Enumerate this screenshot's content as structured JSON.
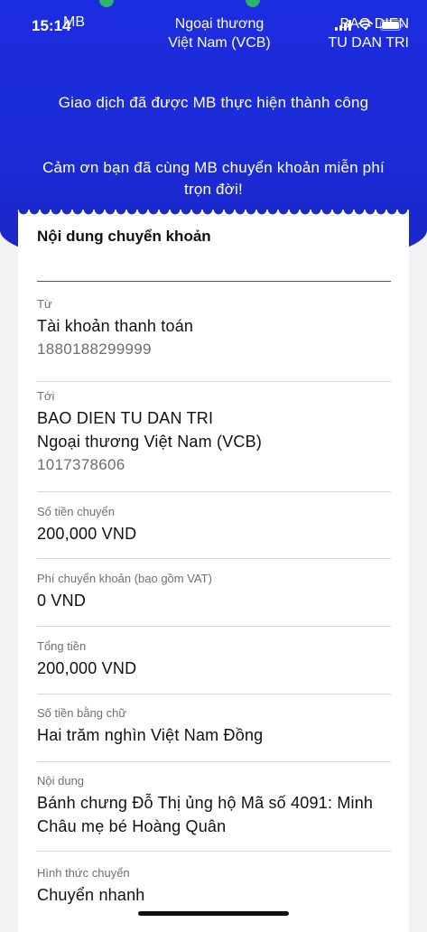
{
  "status": {
    "time": "15:14",
    "icons": [
      "signal-icon",
      "wifi-icon",
      "battery-icon"
    ]
  },
  "header": {
    "sender_bank_short": "MB",
    "receiver_bank": "Ngoại thương Việt Nam (VCB)",
    "receiver_name": "BAO DIEN TU DAN TRI"
  },
  "message": {
    "success": "Giao dịch đã được MB thực hiện thành công",
    "thanks": "Cảm ơn bạn đã cùng MB chuyển khoản miễn phí trọn đời!"
  },
  "receipt": {
    "title": "Nội dung chuyển khoản",
    "from": {
      "label": "Từ",
      "account_type": "Tài khoản thanh toán",
      "account_number": "1880188299999"
    },
    "to": {
      "label": "Tới",
      "name": "BAO DIEN TU DAN TRI",
      "bank": "Ngoại thương Việt Nam (VCB)",
      "account_number": "1017378606"
    },
    "amount": {
      "label": "Số tiền chuyển",
      "value": "200,000 VND"
    },
    "fee": {
      "label": "Phí chuyển khoản (bao gồm VAT)",
      "value": "0 VND"
    },
    "total": {
      "label": "Tổng tiền",
      "value": "200,000 VND"
    },
    "amount_words": {
      "label": "Số tiền bằng chữ",
      "value": "Hai trăm nghìn Việt Nam Đồng"
    },
    "content": {
      "label": "Nội dung",
      "value": "Bánh chưng Đỗ Thị ủng hộ Mã số 4091: Minh Châu mẹ bé Hoàng Quân"
    },
    "method": {
      "label": "Hình thức chuyển",
      "value": "Chuyển nhanh"
    }
  },
  "colors": {
    "brand_blue": "#1b2bd6",
    "accent_green": "#2fb36b"
  }
}
